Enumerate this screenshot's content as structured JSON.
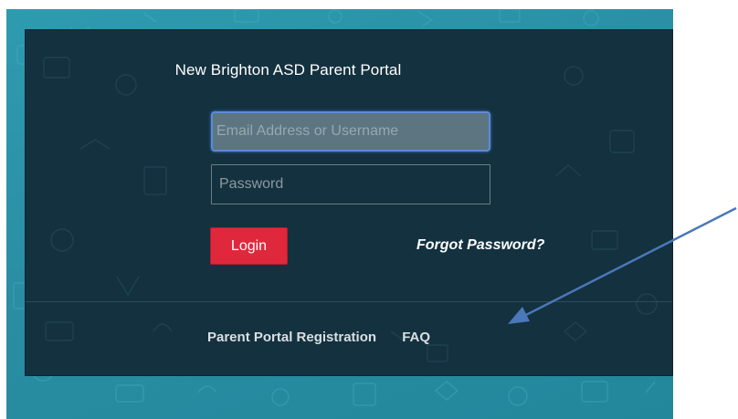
{
  "portal": {
    "title": "New Brighton ASD Parent Portal"
  },
  "form": {
    "email_placeholder": "Email Address or Username",
    "email_value": "",
    "password_placeholder": "Password",
    "password_value": "",
    "login_label": "Login",
    "forgot_label": "Forgot Password?"
  },
  "footer": {
    "registration_label": "Parent Portal Registration",
    "faq_label": "FAQ"
  },
  "colors": {
    "background_teal": "#2a8ea3",
    "panel_dark": "#14313f",
    "login_red": "#e0283c",
    "focus_blue": "#5a8ad8",
    "annotation_arrow": "#4a78b8"
  },
  "annotation": {
    "icon": "arrow-pointer-icon",
    "points_to": "faq-link"
  }
}
